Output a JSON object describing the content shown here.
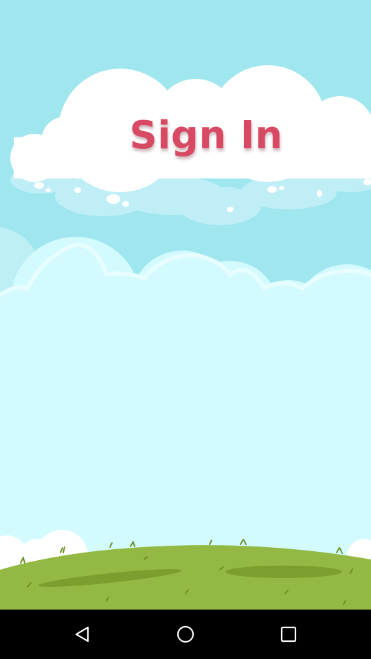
{
  "screen": {
    "title": "Sign In"
  },
  "colors": {
    "sky_top": "#9fe6ee",
    "sky_bottom": "#d3fbff",
    "title": "#d84a63",
    "grass": "#93b944",
    "navbar": "#000000"
  },
  "navigation_bar": {
    "back_icon": "triangle-back-icon",
    "home_icon": "circle-home-icon",
    "recents_icon": "square-recents-icon"
  }
}
